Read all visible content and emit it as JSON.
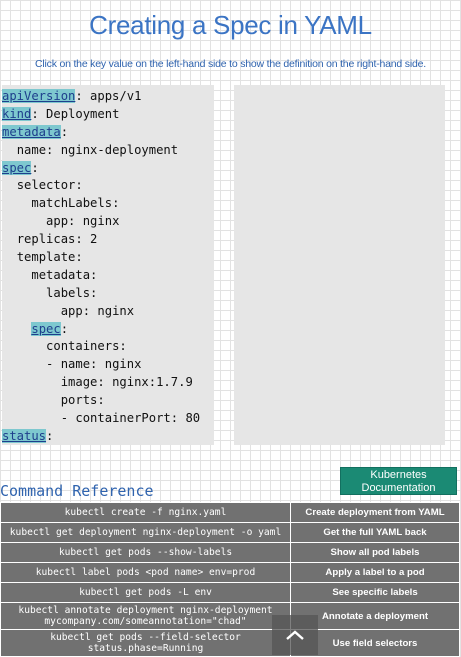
{
  "page": {
    "title": "Creating a Spec in YAML",
    "subtitle": "Click on the key value on the left-hand side to show the definition on the right-hand side."
  },
  "yaml": {
    "lines": [
      {
        "indent": "",
        "key": "apiVersion",
        "rest": ": apps/v1",
        "highlight": true
      },
      {
        "indent": "",
        "key": "kind",
        "rest": ": Deployment",
        "highlight": true
      },
      {
        "indent": "",
        "key": "metadata",
        "rest": ":",
        "highlight": true
      },
      {
        "indent": "  ",
        "key": "",
        "rest": "name: nginx-deployment",
        "highlight": false
      },
      {
        "indent": "",
        "key": "spec",
        "rest": ":",
        "highlight": true
      },
      {
        "indent": "  ",
        "key": "",
        "rest": "selector:",
        "highlight": false
      },
      {
        "indent": "    ",
        "key": "",
        "rest": "matchLabels:",
        "highlight": false
      },
      {
        "indent": "      ",
        "key": "",
        "rest": "app: nginx",
        "highlight": false
      },
      {
        "indent": "  ",
        "key": "",
        "rest": "replicas: 2",
        "highlight": false
      },
      {
        "indent": "  ",
        "key": "",
        "rest": "template:",
        "highlight": false
      },
      {
        "indent": "    ",
        "key": "",
        "rest": "metadata:",
        "highlight": false
      },
      {
        "indent": "      ",
        "key": "",
        "rest": "labels:",
        "highlight": false
      },
      {
        "indent": "        ",
        "key": "",
        "rest": "app: nginx",
        "highlight": false
      },
      {
        "indent": "    ",
        "key": "spec",
        "rest": ":",
        "highlight": true
      },
      {
        "indent": "      ",
        "key": "",
        "rest": "containers:",
        "highlight": false
      },
      {
        "indent": "      ",
        "key": "",
        "rest": "- name: nginx",
        "highlight": false
      },
      {
        "indent": "        ",
        "key": "",
        "rest": "image: nginx:1.7.9",
        "highlight": false
      },
      {
        "indent": "        ",
        "key": "",
        "rest": "ports:",
        "highlight": false
      },
      {
        "indent": "        ",
        "key": "",
        "rest": "- containerPort: 80",
        "highlight": false
      },
      {
        "indent": "",
        "key": "status",
        "rest": ":",
        "highlight": true
      }
    ]
  },
  "definition": {
    "text": ""
  },
  "docs_button": {
    "label": "Kubernetes Documentation"
  },
  "command_reference": {
    "heading": "Command Reference",
    "rows": [
      {
        "command": "kubectl create -f nginx.yaml",
        "description": "Create deployment from YAML"
      },
      {
        "command": "kubectl get deployment nginx-deployment -o yaml",
        "description": "Get the full YAML back"
      },
      {
        "command": "kubectl get pods --show-labels",
        "description": "Show all pod labels"
      },
      {
        "command": "kubectl label pods <pod name> env=prod",
        "description": "Apply a label to a pod"
      },
      {
        "command": "kubectl get pods -L env",
        "description": "See specific labels"
      },
      {
        "command": "kubectl annotate deployment nginx-deployment mycompany.com/someannotation=\"chad\"",
        "description": "Annotate a deployment"
      },
      {
        "command": "kubectl get pods --field-selector status.phase=Running",
        "description": "Use field selectors"
      }
    ]
  },
  "scroll_top": {
    "icon": "chevron-up-icon"
  },
  "colors": {
    "title": "#3b74c4",
    "key_highlight": "#7ec8cf",
    "panel": "#e6e6e6",
    "docs_button": "#1b8a74",
    "table_cell": "#717171"
  }
}
